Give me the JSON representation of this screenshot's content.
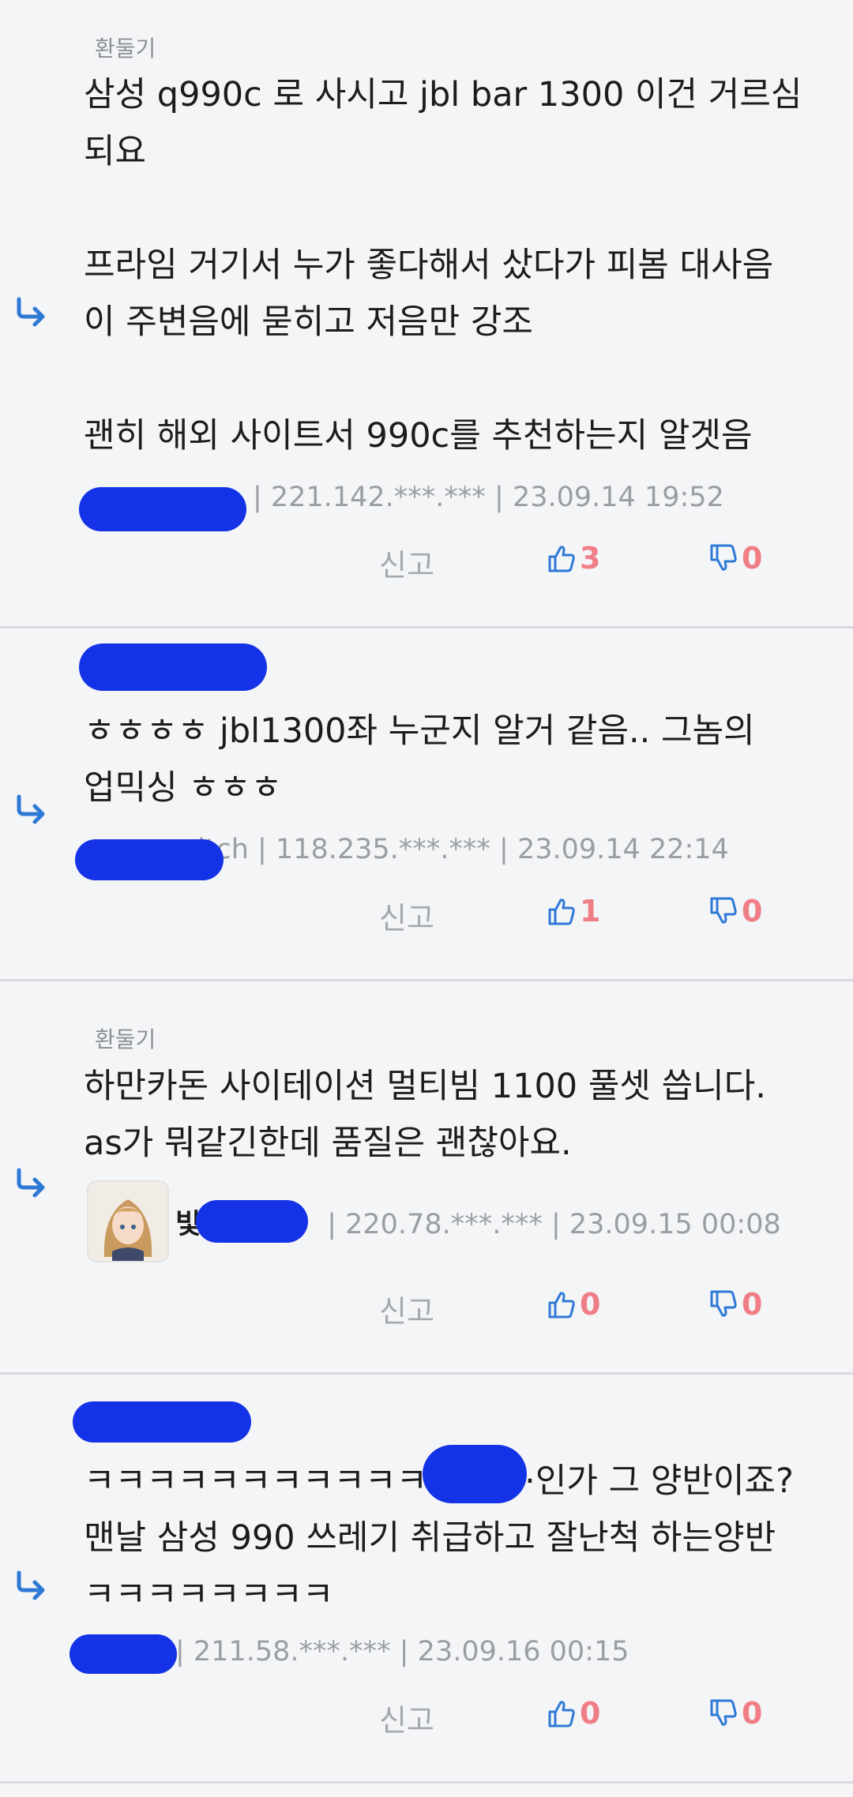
{
  "comments": [
    {
      "badge": "환둘기",
      "text": "삼성 q990c 로 사시고 jbl bar 1300 이건 거르심\n되요\n\n프라임 거기서 누가 좋다해서 샀다가 피봄 대사음\n이 주변음에 묻히고 저음만 강조\n\n괜히 해외 사이트서 990c를 추천하는지 알겟음",
      "meta": "| 221.142.***.*** | 23.09.14 19:52",
      "report": "신고",
      "up": "3",
      "down": "0"
    },
    {
      "badge": "",
      "text": "ㅎㅎㅎㅎ jbl1300좌 누군지 알거 같음.. 그놈의\n업믹싱 ㅎㅎㅎ",
      "author_tail": "itch",
      "meta": "| 118.235.***.*** | 23.09.14 22:14",
      "report": "신고",
      "up": "1",
      "down": "0"
    },
    {
      "badge": "환둘기",
      "text": "하만카돈 사이테이션 멀티빔 1100 풀셋 씁니다.\nas가 뭐같긴한데 품질은 괜찮아요.",
      "author_head": "빛",
      "meta": "| 220.78.***.*** | 23.09.15 00:08",
      "report": "신고",
      "up": "0",
      "down": "0"
    },
    {
      "badge": "",
      "text": "ㅋㅋㅋㅋㅋㅋㅋㅋㅋㅋㅋ         ·인가 그 양반이죠?\n맨날 삼성 990 쓰레기 취급하고 잘난척 하는양반\nㅋㅋㅋㅋㅋㅋㅋㅋ",
      "meta": "| 211.58.***.*** | 23.09.16 00:15",
      "report": "신고",
      "up": "0",
      "down": "0"
    }
  ],
  "colors": {
    "accent": "#2f79d6",
    "vote": "#f07e86",
    "redaction": "#1433e6"
  },
  "icons": {
    "reply": "reply-arrow-icon",
    "up": "thumbs-up-icon",
    "down": "thumbs-down-icon"
  }
}
